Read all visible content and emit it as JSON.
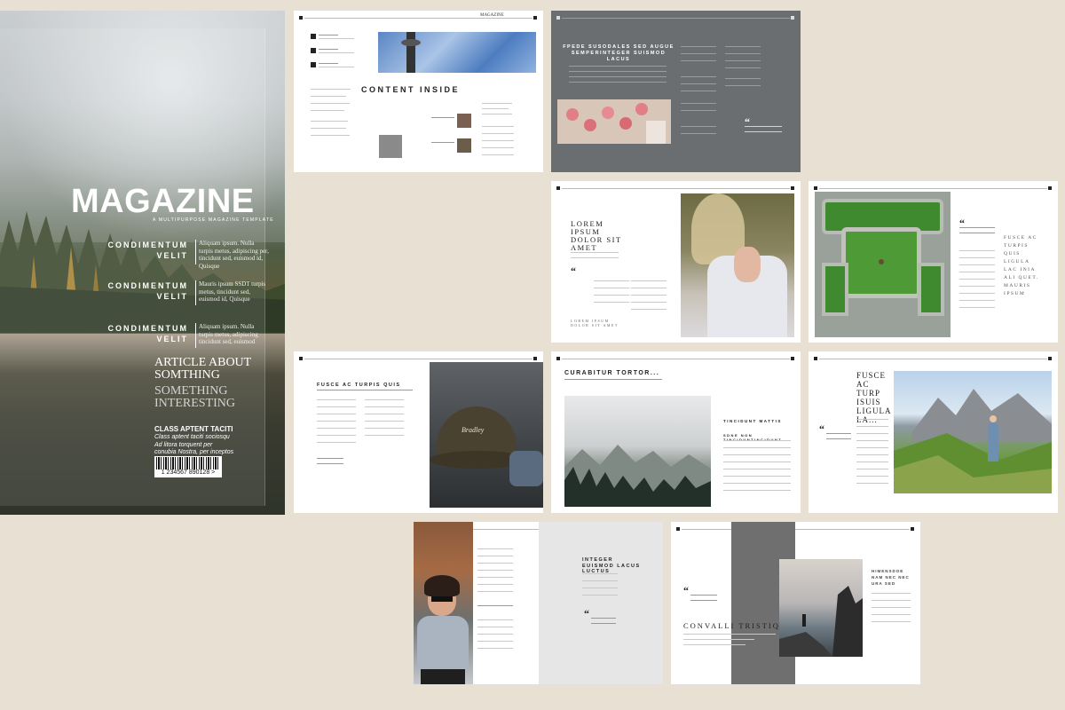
{
  "cover": {
    "title": "MAGAZINE",
    "tagline": "A MULTIPURPOSE MAGAZINE TEMPLATE",
    "features": [
      {
        "label": "CONDIMENTUM VELIT",
        "body": "Aliquam ipsum. Nulla turpis metus, adipiscing per, tincidunt sed, euismod id, Quisque"
      },
      {
        "label": "CONDIMENTUM VELIT",
        "body": "Mauris ipsum SSDT turpis metus, tincidunt sed, euismod id, Quisque"
      },
      {
        "label": "CONDIMENTUM VELIT",
        "body": "Aliquam ipsum. Nulla turpis metus, adipiscing tincidunt sed, euismod"
      }
    ],
    "article_line1": "ARTICLE ABOUT",
    "article_line2": "SOMTHING",
    "article_line3": "SOMETHING",
    "article_line4": "INTERESTING",
    "class_title": "CLASS APTENT TACITI",
    "class_body": "Class aptent taciti sociosqu Ad litora torquent per conubia Nostra, per inceptos",
    "barcode": "1 234567 890128 >"
  },
  "spreads": {
    "contents": {
      "title": "CONTENT INSIDE",
      "masthead": "MAGAZINE",
      "side_title": "QUISQUE VOLUTPAT CONDI. MENTUM VELI CLASS APTENT LITORA TORQUENT"
    },
    "grey": {
      "title": "FPEDE SUSODALES SED AUGUE SEMPERINTEGER SUISMOD LACUS"
    },
    "lorem": {
      "title": "LOREM IPSUM DOLOR SIT AMET",
      "caption": "LOREM IPSUM DOLOR SIT AMET"
    },
    "grass": {
      "side": "FUSCE AC TURPIS QUIS LIGULA LAC INIA ALI QUET. MAURIS IPSUM"
    },
    "cap": {
      "title": "FUSCE AC TURPIS QUIS"
    },
    "curabitur": {
      "title": "CURABITUR TORTOR...",
      "sub1": "TINCIDUNT MATTIS",
      "sub2": "SDNE NON TINCIDUNTINCIDUNT"
    },
    "mountain": {
      "title": "FUSCE AC TURP ISUIS LIGULA LA..."
    },
    "integer": {
      "title": "INTEGER EUISMOD LACUS LUCTUS"
    },
    "convalli": {
      "title": "CONVALLI TRISTIQU",
      "side": "HIMENSDOE NAM NEC NEC URA SED"
    }
  }
}
